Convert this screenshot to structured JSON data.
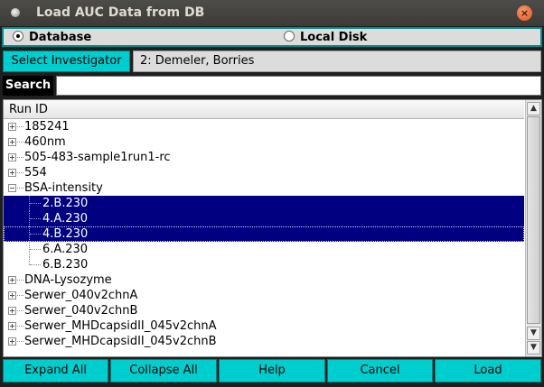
{
  "window": {
    "title": "Load AUC Data from DB",
    "close_glyph": "×"
  },
  "source": {
    "option1": "Database",
    "option2": "Local Disk",
    "selected": "Database"
  },
  "investigator": {
    "button_label": "Select Investigator",
    "value": "2: Demeler, Borries"
  },
  "search": {
    "label": "Search",
    "value": ""
  },
  "tree": {
    "column_header": "Run ID",
    "rows": [
      {
        "label": "185241",
        "level": 0,
        "expanded": false,
        "selected": false
      },
      {
        "label": "460nm",
        "level": 0,
        "expanded": false,
        "selected": false
      },
      {
        "label": "505-483-sample1run1-rc",
        "level": 0,
        "expanded": false,
        "selected": false
      },
      {
        "label": "554",
        "level": 0,
        "expanded": false,
        "selected": false
      },
      {
        "label": "BSA-intensity",
        "level": 0,
        "expanded": true,
        "selected": false
      },
      {
        "label": "2.B.230",
        "level": 1,
        "selected": true
      },
      {
        "label": "4.A.230",
        "level": 1,
        "selected": true
      },
      {
        "label": "4.B.230",
        "level": 1,
        "selected": true,
        "focus": true
      },
      {
        "label": "6.A.230",
        "level": 1,
        "selected": false
      },
      {
        "label": "6.B.230",
        "level": 1,
        "selected": false,
        "last": true
      },
      {
        "label": "DNA-Lysozyme",
        "level": 0,
        "expanded": false,
        "selected": false
      },
      {
        "label": "Serwer_040v2chnA",
        "level": 0,
        "expanded": false,
        "selected": false
      },
      {
        "label": "Serwer_040v2chnB",
        "level": 0,
        "expanded": false,
        "selected": false
      },
      {
        "label": "Serwer_MHDcapsidII_045v2chnA",
        "level": 0,
        "expanded": false,
        "selected": false
      },
      {
        "label": "Serwer_MHDcapsidII_045v2chnB",
        "level": 0,
        "expanded": false,
        "selected": false
      }
    ]
  },
  "scrollbar": {
    "up_glyph": "▲",
    "down_glyph": "▼"
  },
  "buttons": {
    "expand_all": "Expand All",
    "collapse_all": "Collapse All",
    "help": "Help",
    "cancel": "Cancel",
    "load": "Load"
  },
  "colors": {
    "accent": "#00cdcd",
    "selection": "#000080",
    "frame": "#008b8b"
  }
}
